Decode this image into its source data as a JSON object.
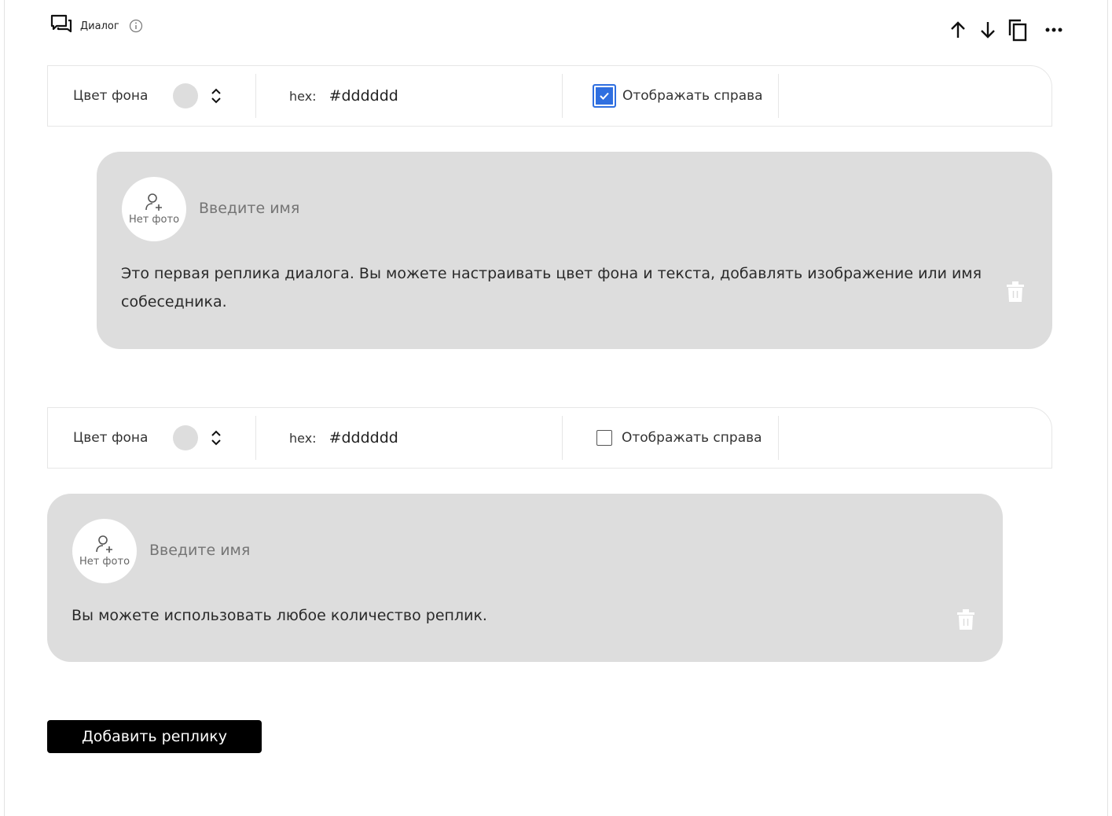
{
  "header": {
    "title": "Диалог",
    "icon": "chat-bubbles-icon",
    "info_icon": "info-icon"
  },
  "toolbar": {
    "icons": [
      "arrow-up-icon",
      "arrow-down-icon",
      "copy-icon",
      "more-icon"
    ]
  },
  "replicas": [
    {
      "settings": {
        "color_label": "Цвет фона",
        "hex_label": "hex:",
        "hex_value": "#dddddd",
        "show_right_label": "Отображать справа",
        "show_right_checked": true
      },
      "avatar_text": "Нет фото",
      "name_placeholder": "Введите имя",
      "text_line1": "Это первая реплика диалога. Вы можете настраивать цвет фона и текста, добавлять изображение или имя",
      "text_line2": "собеседника.",
      "bubble_color": "#dddddd"
    },
    {
      "settings": {
        "color_label": "Цвет фона",
        "hex_label": "hex:",
        "hex_value": "#dddddd",
        "show_right_label": "Отображать справа",
        "show_right_checked": false
      },
      "avatar_text": "Нет фото",
      "name_placeholder": "Введите имя",
      "text_line1": "Вы можете использовать любое количество реплик.",
      "bubble_color": "#dddddd"
    }
  ],
  "add_button_label": "Добавить реплику",
  "colors": {
    "accent": "#2f6fe0",
    "bubble": "#dddddd",
    "button": "#000000"
  }
}
